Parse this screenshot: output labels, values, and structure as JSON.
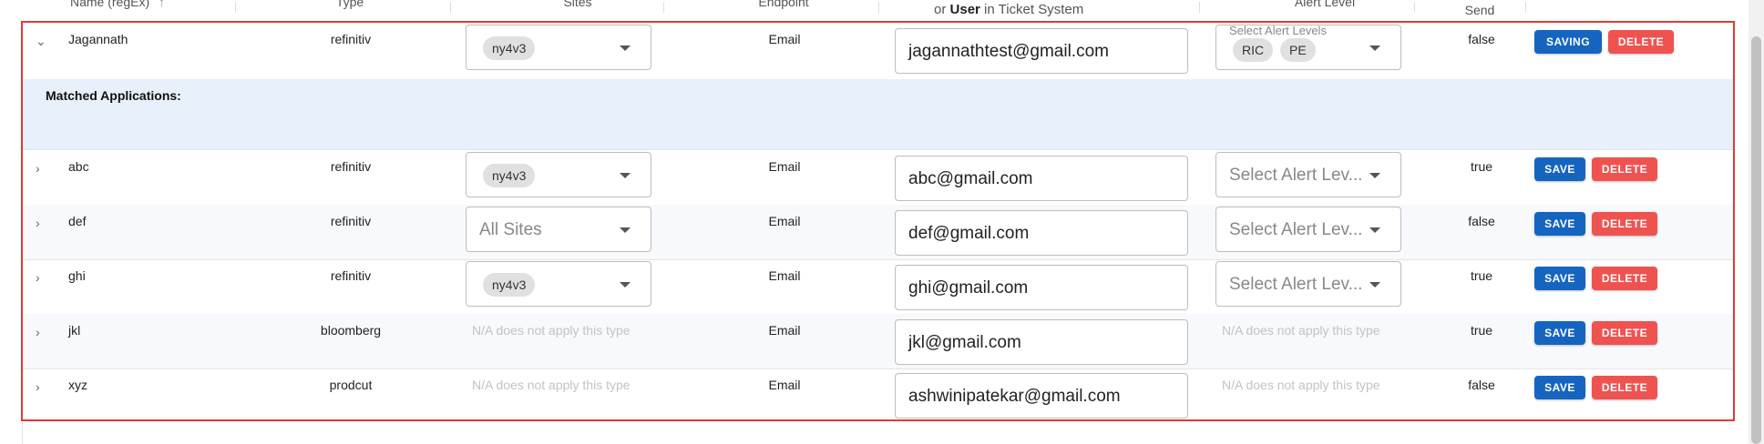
{
  "header": {
    "name": "Name (regEx)",
    "sort_icon": "↑",
    "type": "Type",
    "sites": "Sites",
    "endpoint": "Endpoint",
    "contact_sub_prefix": "or",
    "contact_sub_bold": "User",
    "contact_sub_suffix": "in Ticket System",
    "alert_level": "Alert Level",
    "send": "Send"
  },
  "expanded_row": {
    "name": "Jagannath",
    "type": "refinitiv",
    "site_chip": "ny4v3",
    "endpoint": "Email",
    "contact": "jagannathtest@gmail.com",
    "alert_floating_label": "Select Alert Levels",
    "alert_chips": [
      "RIC",
      "PE"
    ],
    "send": "false",
    "save_label": "SAVING",
    "delete_label": "DELETE",
    "matched_title": "Matched Applications:"
  },
  "rows": [
    {
      "name": "abc",
      "type": "refinitiv",
      "site_chip": "ny4v3",
      "site_placeholder": "",
      "endpoint": "Email",
      "contact": "abc@gmail.com",
      "alert": "Select Alert Lev...",
      "na_sites": "",
      "na_alert": "",
      "send": "true",
      "save_label": "SAVE",
      "delete_label": "DELETE"
    },
    {
      "name": "def",
      "type": "refinitiv",
      "site_chip": "",
      "site_placeholder": "All Sites",
      "endpoint": "Email",
      "contact": "def@gmail.com",
      "alert": "Select Alert Lev...",
      "na_sites": "",
      "na_alert": "",
      "send": "false",
      "save_label": "SAVE",
      "delete_label": "DELETE"
    },
    {
      "name": "ghi",
      "type": "refinitiv",
      "site_chip": "ny4v3",
      "site_placeholder": "",
      "endpoint": "Email",
      "contact": "ghi@gmail.com",
      "alert": "Select Alert Lev...",
      "na_sites": "",
      "na_alert": "",
      "send": "true",
      "save_label": "SAVE",
      "delete_label": "DELETE"
    },
    {
      "name": "jkl",
      "type": "bloomberg",
      "site_chip": "",
      "site_placeholder": "",
      "endpoint": "Email",
      "contact": "jkl@gmail.com",
      "alert": "",
      "na_sites": "N/A does not apply this type",
      "na_alert": "N/A does not apply this type",
      "send": "true",
      "save_label": "SAVE",
      "delete_label": "DELETE"
    },
    {
      "name": "xyz",
      "type": "prodcut",
      "site_chip": "",
      "site_placeholder": "",
      "endpoint": "Email",
      "contact": "ashwinipatekar@gmail.com",
      "alert": "",
      "na_sites": "N/A does not apply this type",
      "na_alert": "N/A does not apply this type",
      "send": "false",
      "save_label": "SAVE",
      "delete_label": "DELETE"
    }
  ],
  "icons": {
    "expand": "chevron-right-icon",
    "collapse": "chevron-down-icon",
    "dropdown": "dropdown-arrow-icon"
  },
  "colors": {
    "save": "#1565c0",
    "delete": "#ef5350",
    "highlight_border": "#e53935",
    "matched_bg": "#e7f0fb"
  }
}
